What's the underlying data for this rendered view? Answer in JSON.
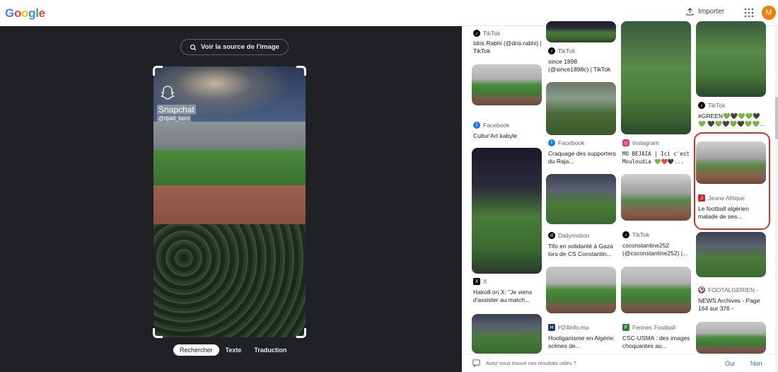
{
  "header": {
    "logo_letters": [
      {
        "ch": "G",
        "color": "#4285F4"
      },
      {
        "ch": "o",
        "color": "#EA4335"
      },
      {
        "ch": "o",
        "color": "#FBBC05"
      },
      {
        "ch": "g",
        "color": "#4285F4"
      },
      {
        "ch": "l",
        "color": "#34A853"
      },
      {
        "ch": "e",
        "color": "#EA4335"
      }
    ],
    "import_label": "Importer",
    "avatar_letter": "M",
    "avatar_color": "#f57c00"
  },
  "viewer": {
    "source_button": "Voir la source de l'image",
    "snap_label": "Snapchat",
    "snap_user": "@djalil_kero",
    "modes": [
      "Rechercher",
      "Texte",
      "Traduction"
    ],
    "active_mode": "Rechercher"
  },
  "results": [
    {
      "source": "TikTok",
      "icon": "tiktok-icon",
      "icon_color": "#000000",
      "title": "Idris Rabhi (@dris.rabhi) | TikTok"
    },
    {
      "source": "Facebook",
      "icon": "facebook-icon",
      "icon_color": "#1877F2",
      "title": "Cultur'Art kabyle"
    },
    {
      "source": "X",
      "icon": "x-icon",
      "icon_color": "#000000",
      "title": "Hako8 on X: \"Je viens d'assister au match..."
    },
    {
      "source": "TikTok",
      "icon": "tiktok-icon",
      "icon_color": "#000000",
      "title": "since 1898 (@since1898c) | TikTok"
    },
    {
      "source": "Facebook",
      "icon": "facebook-icon",
      "icon_color": "#1877F2",
      "title": "Craquage des supporters du Raja..."
    },
    {
      "source": "Dailymotion",
      "icon": "dailymotion-icon",
      "icon_color": "#000000",
      "title": "Tifo en solidarité à Gaza lors de CS Constantin..."
    },
    {
      "source": "H24info.ma",
      "icon": "h24info-icon",
      "icon_color": "#1a3a6a",
      "title": "Hooliganisme en Algérie: scènes de..."
    },
    {
      "source": "Instagram",
      "icon": "instagram-icon",
      "icon_color": "#E1306C",
      "title": "MO BEJAIA | Ici c'est Mouloudia 💚❤️🖤..."
    },
    {
      "source": "TikTok",
      "icon": "tiktok-icon",
      "icon_color": "#000000",
      "title": "csconstantine252 (@csconstantine252) |..."
    },
    {
      "source": "Fennec Football",
      "icon": "fennec-icon",
      "icon_color": "#2e7d32",
      "title": "CSC-USMA : des images choquantes au..."
    },
    {
      "source": "TikTok",
      "icon": "tiktok-icon",
      "icon_color": "#000000",
      "title": "#GREEN💚🖤💚💚🖤💚 🖤💚🖤💚🖤💚💚..."
    },
    {
      "source": "Jeune Afrique",
      "icon": "jeune-afrique-icon",
      "icon_color": "#c62828",
      "title": "Le football algérien malade de ses..."
    },
    {
      "source": "FOOTALGERIEN -",
      "icon": "footalgerien-icon",
      "icon_color": "#c62828",
      "title": "NEWS Archives - Page 164 sur 376 -"
    }
  ],
  "feedback": {
    "question": "Avez-vous trouvé ces résultats utiles ?",
    "yes": "Oui",
    "no": "Non"
  }
}
